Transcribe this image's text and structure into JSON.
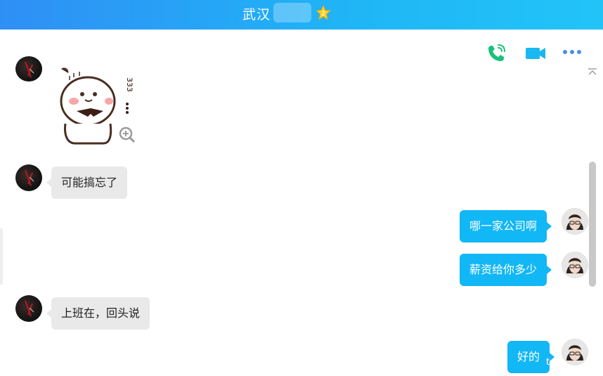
{
  "header": {
    "title": "武汉"
  },
  "toolbar": {
    "voice_call_icon": "phone-icon",
    "video_call_icon": "video-camera-icon",
    "more_icon": "more-dots-icon"
  },
  "messages": [
    {
      "side": "left",
      "type": "sticker"
    },
    {
      "side": "left",
      "type": "text",
      "text": "可能搞忘了"
    },
    {
      "side": "right",
      "type": "text",
      "text": "哪一家公司啊"
    },
    {
      "side": "right",
      "type": "text",
      "text": "薪资给你多少"
    },
    {
      "side": "left",
      "type": "text",
      "text": "上班在，回头说"
    },
    {
      "side": "right",
      "type": "text",
      "text": "好的"
    }
  ],
  "watermark": "t",
  "colors": {
    "titlebar_start": "#2f8ff5",
    "titlebar_end": "#22c4f8",
    "bubble_sent": "#12b7f5",
    "bubble_received": "#e9e9e9",
    "phone_green": "#19c27a",
    "video_cyan": "#1ab8f0"
  }
}
